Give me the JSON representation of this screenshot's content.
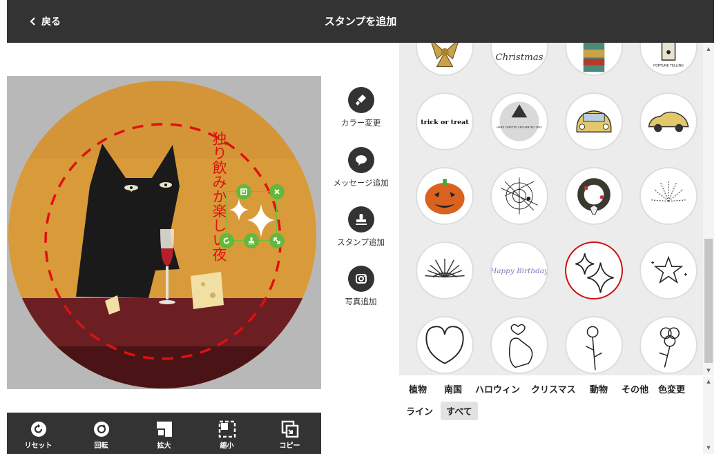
{
  "header": {
    "back_label": "戻る",
    "title": "スタンプを追加"
  },
  "canvas": {
    "message_text": "独り飲みか楽しい夜"
  },
  "tools": [
    {
      "label": "カラー変更",
      "icon": "paint-brush-icon"
    },
    {
      "label": "メッセージ追加",
      "icon": "speech-bubble-icon"
    },
    {
      "label": "スタンプ追加",
      "icon": "stamp-icon"
    },
    {
      "label": "写真追加",
      "icon": "camera-icon"
    }
  ],
  "bottom_bar": [
    {
      "label": "リセット",
      "icon": "reset-icon"
    },
    {
      "label": "回転",
      "icon": "rotate-icon"
    },
    {
      "label": "拡大",
      "icon": "enlarge-icon"
    },
    {
      "label": "縮小",
      "icon": "shrink-icon"
    },
    {
      "label": "コピー",
      "icon": "copy-icon"
    }
  ],
  "stickers": {
    "row0": [
      "Christmas",
      "FORTUNE TELLING"
    ],
    "row1": [
      "trick or treat",
      "HAND CRAFTED ENCHANTED 1692"
    ],
    "row3": [
      "Happy Birthday"
    ],
    "selected": "sparkle stars"
  },
  "categories": [
    "植物",
    "南国",
    "ハロウィン",
    "クリスマス",
    "動物",
    "その他",
    "色変更",
    "ライン",
    "すべて"
  ],
  "active_category": "すべて",
  "colors": {
    "header": "#333333",
    "accent_green": "#62b83a",
    "message_red": "#e01010",
    "selected_border": "#cc1111"
  }
}
